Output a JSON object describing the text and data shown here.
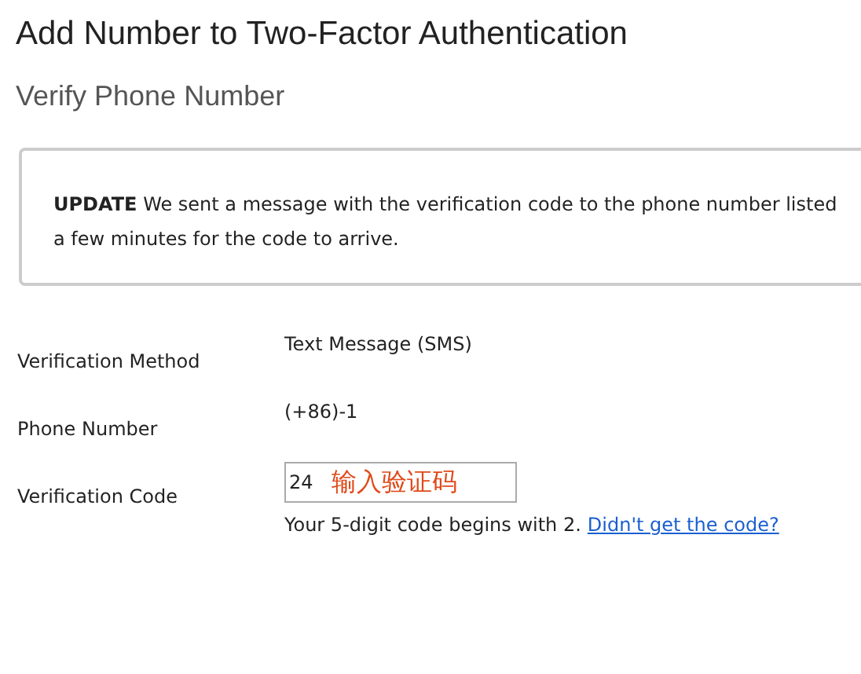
{
  "page": {
    "title": "Add Number to Two-Factor Authentication",
    "subtitle": "Verify Phone Number"
  },
  "notice": {
    "text": "**UPDATE** We sent a message with the verification code to the phone number listed",
    "text_2": "a few minutes for the code to arrive."
  },
  "fields": [
    {
      "kind": "text",
      "label": "Verification Method",
      "value": "Text Message (SMS)"
    },
    {
      "kind": "text",
      "label": "Phone Number",
      "value": "(+86)-1"
    },
    {
      "kind": "input",
      "label": "Verification Code",
      "value": "24",
      "annotation": "输入验证码",
      "hint": "Your 5-digit code begins with 2.",
      "link": "Didn't get the code?"
    }
  ]
}
